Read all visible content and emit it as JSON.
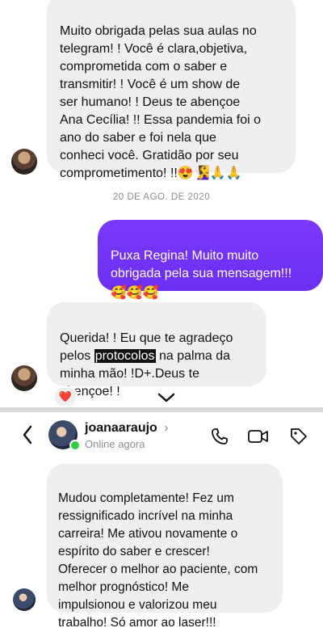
{
  "thread_top": {
    "message_1": {
      "text": "Muito obrigada pelas sua aulas no\ntelegram! ! Você é clara,objetiva,\ncomprometida com o saber e\ntransmitir! ! Você é um show de\nser humano! ! Deus te abençoe\nAna Cecília! !! Essa pandemia foi o\nano do saber e foi nela que\nconheci você. Gratidão por seu\ncomprometimento! !!",
      "emojis": "😍🧏‍♀️🙏🙏"
    },
    "date_separator": "20 DE AGO. DE 2020",
    "message_2_out": {
      "text": "Puxa Regina! Muito muito\nobrigada pela sua mensagem!!!",
      "emojis": "🥰🥰🥰"
    },
    "message_3": {
      "part_1": "Querida! ! Eu que te agradeço\npelos ",
      "highlight": "protocolos",
      "part_2": " na palma da\nminha mão! !D+.Deus te\nabençoe! !"
    },
    "reaction": "❤️"
  },
  "header": {
    "username": "joanaaraujo",
    "status": "Online agora",
    "back_icon": "chevron-left-icon",
    "call_icon": "phone-icon",
    "video_icon": "video-camera-icon",
    "tag_icon": "tag-icon"
  },
  "thread_bottom": {
    "message_1": "Mudou completamente! Fez um\nressignificado incrível na minha\ncarreira! Me ativou novamente o\nespírito do saber e crescer!\nOferecer o melhor ao paciente, com\nmelhor prognóstico! Me\nimpulsionou e valorizou meu\ntrabalho!  Só amor ao laser!!!"
  },
  "colors": {
    "outgoing_bubble": "#7a39ff",
    "incoming_bubble": "#efefef",
    "online_dot": "#2ecc40",
    "date_text": "#8e8e8e"
  }
}
